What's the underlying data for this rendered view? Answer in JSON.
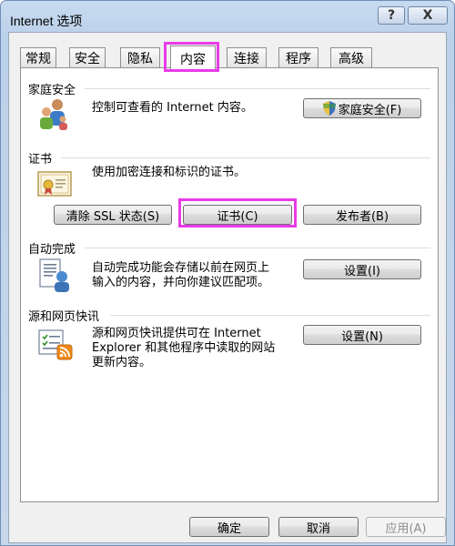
{
  "window": {
    "title": "Internet 选项",
    "help_glyph": "?",
    "close_glyph": "X"
  },
  "tabs": [
    {
      "label": "常规"
    },
    {
      "label": "安全"
    },
    {
      "label": "隐私"
    },
    {
      "label": "内容",
      "selected": true
    },
    {
      "label": "连接"
    },
    {
      "label": "程序"
    },
    {
      "label": "高级"
    }
  ],
  "family_safety": {
    "title": "家庭安全",
    "description": "控制可查看的 Internet 内容。",
    "button": "家庭安全(F)"
  },
  "certificates": {
    "title": "证书",
    "description": "使用加密连接和标识的证书。",
    "clear_ssl_button": "清除 SSL 状态(S)",
    "certificates_button": "证书(C)",
    "publishers_button": "发布者(B)"
  },
  "autocomplete": {
    "title": "自动完成",
    "description_line1": "自动完成功能会存储以前在网页上",
    "description_line2": "输入的内容，并向你建议匹配项。",
    "settings_button": "设置(I)"
  },
  "feeds": {
    "title": "源和网页快讯",
    "description_line1": "源和网页快讯提供可在 Internet",
    "description_line2": "Explorer 和其他程序中读取的网站",
    "description_line3": "更新内容。",
    "settings_button": "设置(N)"
  },
  "footer": {
    "ok_button": "确定",
    "cancel_button": "取消",
    "apply_button": "应用(A)"
  },
  "highlight_color": "#e83be8"
}
